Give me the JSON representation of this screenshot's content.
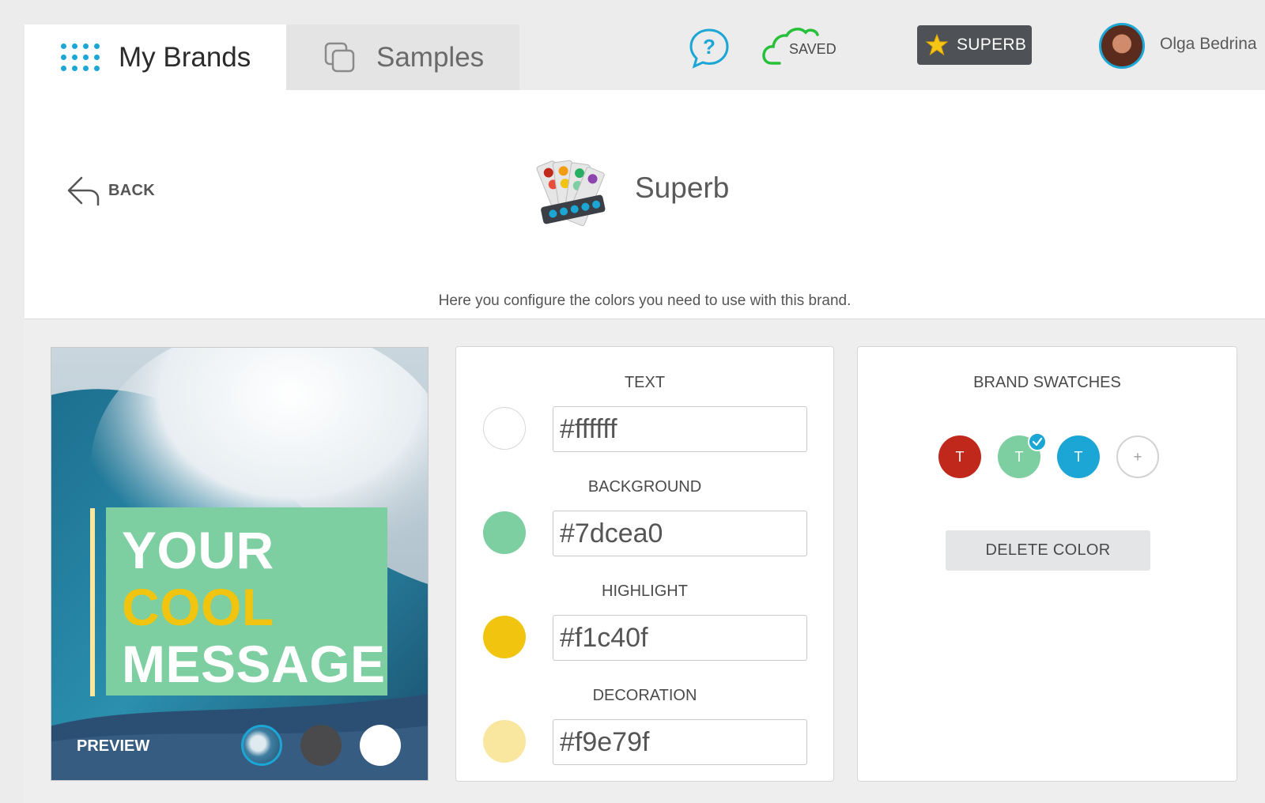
{
  "tabs": {
    "my_brands": "My Brands",
    "samples": "Samples"
  },
  "header": {
    "help_icon": "question-bubble-icon",
    "saved_label": "SAVED",
    "plan_badge": "SUPERB",
    "user_name": "Olga Bedrina"
  },
  "brand": {
    "back_label": "BACK",
    "name": "Superb",
    "description": "Here you configure the colors you need to use with this brand."
  },
  "preview": {
    "line1": "YOUR",
    "line2": "COOL",
    "line3": "MESSAGE",
    "label": "PREVIEW"
  },
  "colors": [
    {
      "label": "TEXT",
      "value": "#ffffff"
    },
    {
      "label": "BACKGROUND",
      "value": "#7dcea0"
    },
    {
      "label": "HIGHLIGHT",
      "value": "#f1c40f"
    },
    {
      "label": "DECORATION",
      "value": "#f9e79f"
    }
  ],
  "swatches": {
    "title": "BRAND SWATCHES",
    "items": [
      {
        "letter": "T",
        "color": "#c0281b",
        "selected": false
      },
      {
        "letter": "T",
        "color": "#7dcea0",
        "selected": true
      },
      {
        "letter": "T",
        "color": "#1ba6d6",
        "selected": false
      }
    ],
    "add_symbol": "+",
    "delete_label": "DELETE COLOR"
  },
  "accent_color": "#1ba6d6"
}
